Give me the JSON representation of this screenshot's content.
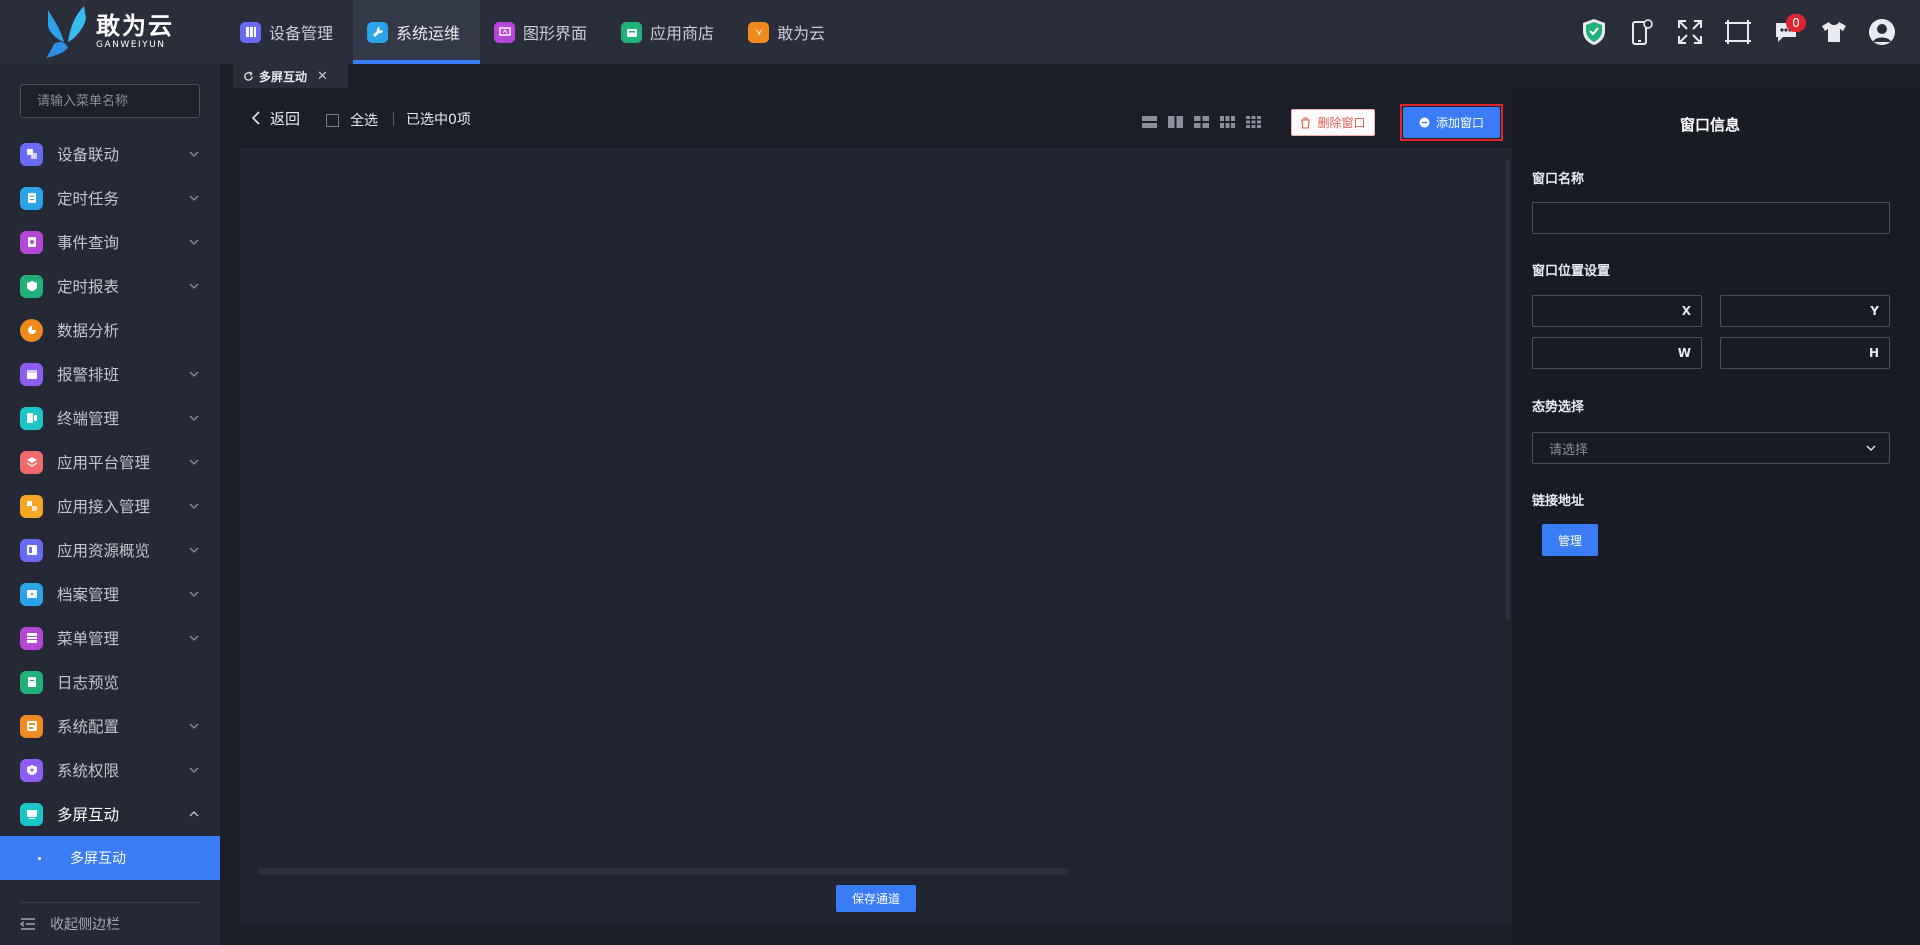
{
  "brand": {
    "name": "敢为云",
    "subtitle": "GANWEIYUN"
  },
  "top_nav": [
    {
      "label": "设备管理",
      "icon": "device-icon",
      "color": "#6a6bf5",
      "active": false
    },
    {
      "label": "系统运维",
      "icon": "wrench-icon",
      "color": "#2aa3e8",
      "active": true
    },
    {
      "label": "图形界面",
      "icon": "graphic-icon",
      "color": "#b447d6",
      "active": false
    },
    {
      "label": "应用商店",
      "icon": "store-icon",
      "color": "#22b07a",
      "active": false
    },
    {
      "label": "敢为云",
      "icon": "cloud-app-icon",
      "color": "#f08a1c",
      "active": false
    }
  ],
  "header_tools": {
    "message_count": "0"
  },
  "sidebar": {
    "search_placeholder": "请输入菜单名称",
    "items": [
      {
        "label": "设备联动",
        "icon": "linkage-icon",
        "color": "#6a6bf5",
        "expandable": true
      },
      {
        "label": "定时任务",
        "icon": "task-icon",
        "color": "#2aa3e8",
        "expandable": true
      },
      {
        "label": "事件查询",
        "icon": "event-icon",
        "color": "#b447d6",
        "expandable": true
      },
      {
        "label": "定时报表",
        "icon": "report-icon",
        "color": "#22b07a",
        "expandable": true
      },
      {
        "label": "数据分析",
        "icon": "analysis-icon",
        "color": "#f08a1c",
        "expandable": false
      },
      {
        "label": "报警排班",
        "icon": "schedule-icon",
        "color": "#8e5cf0",
        "expandable": true
      },
      {
        "label": "终端管理",
        "icon": "terminal-icon",
        "color": "#1cc6c6",
        "expandable": true
      },
      {
        "label": "应用平台管理",
        "icon": "platform-icon",
        "color": "#f06a6a",
        "expandable": true
      },
      {
        "label": "应用接入管理",
        "icon": "access-icon",
        "color": "#f5a623",
        "expandable": true
      },
      {
        "label": "应用资源概览",
        "icon": "resource-icon",
        "color": "#6a6bf5",
        "expandable": true
      },
      {
        "label": "档案管理",
        "icon": "archive-icon",
        "color": "#2aa3e8",
        "expandable": true
      },
      {
        "label": "菜单管理",
        "icon": "menu-manage-icon",
        "color": "#b447d6",
        "expandable": true
      },
      {
        "label": "日志预览",
        "icon": "log-icon",
        "color": "#22b07a",
        "expandable": false
      },
      {
        "label": "系统配置",
        "icon": "config-icon",
        "color": "#f08a1c",
        "expandable": true
      },
      {
        "label": "系统权限",
        "icon": "permission-icon",
        "color": "#8e5cf0",
        "expandable": true
      },
      {
        "label": "多屏互动",
        "icon": "multiscreen-icon",
        "color": "#1cc6c6",
        "expandable": true,
        "open": true
      }
    ],
    "submenu_active": "多屏互动",
    "collapse_label": "收起侧边栏"
  },
  "tabs": [
    {
      "label": "多屏互动"
    }
  ],
  "toolbar": {
    "back_label": "返回",
    "select_all_label": "全选",
    "selected_count_text": "已选中0项",
    "delete_label": "删除窗口",
    "add_label": "添加窗口"
  },
  "canvas": {
    "save_label": "保存通道"
  },
  "window_info": {
    "title": "窗口信息",
    "name_label": "窗口名称",
    "name_value": "",
    "position_label": "窗口位置设置",
    "x_suffix": "X",
    "y_suffix": "Y",
    "w_suffix": "W",
    "h_suffix": "H",
    "situation_label": "态势选择",
    "situation_placeholder": "请选择",
    "link_label": "链接地址",
    "manage_label": "管理"
  },
  "colors": {
    "accent": "#3a7cf5",
    "danger": "#e0252d",
    "header_bg": "#2a2e3b",
    "sidebar_bg": "#252936"
  }
}
